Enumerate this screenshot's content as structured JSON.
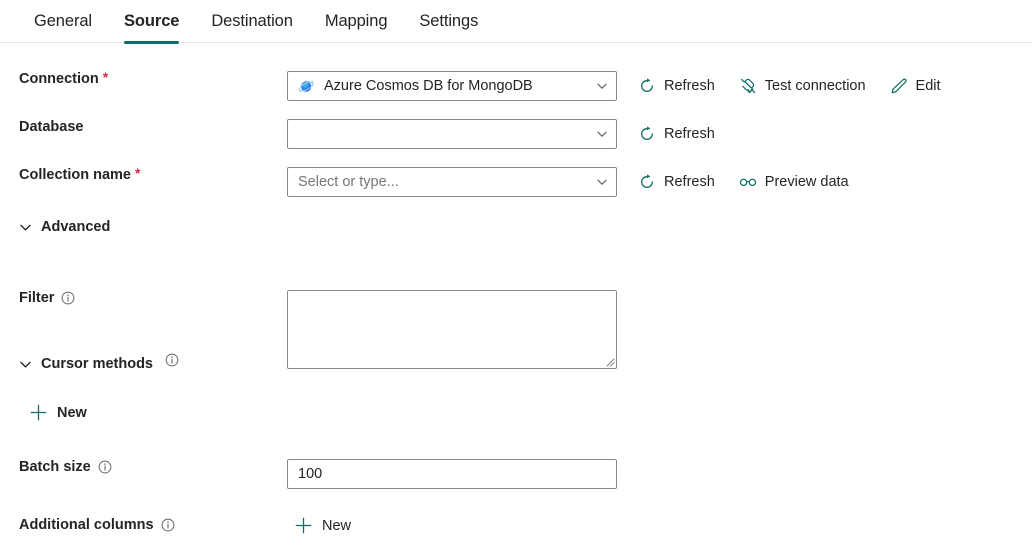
{
  "tabs": [
    {
      "label": "General",
      "active": false
    },
    {
      "label": "Source",
      "active": true
    },
    {
      "label": "Destination",
      "active": false
    },
    {
      "label": "Mapping",
      "active": false
    },
    {
      "label": "Settings",
      "active": false
    }
  ],
  "accent_color": "#0f6e64",
  "required_color": "#c4314b",
  "fields": {
    "connection": {
      "label": "Connection",
      "required": "*",
      "value": "Azure Cosmos DB for MongoDB",
      "icon": "azure-cosmos-db-icon",
      "actions": [
        {
          "label": "Refresh",
          "icon": "refresh-icon"
        },
        {
          "label": "Test connection",
          "icon": "plug-check-icon"
        },
        {
          "label": "Edit",
          "icon": "pencil-icon"
        }
      ]
    },
    "database": {
      "label": "Database",
      "value": "",
      "actions": [
        {
          "label": "Refresh",
          "icon": "refresh-icon"
        }
      ]
    },
    "collection": {
      "label": "Collection name",
      "required": "*",
      "value": "",
      "placeholder": "Select or type...",
      "actions": [
        {
          "label": "Refresh",
          "icon": "refresh-icon"
        },
        {
          "label": "Preview data",
          "icon": "glasses-icon"
        }
      ]
    },
    "filter": {
      "label": "Filter",
      "value": "",
      "info": "info-icon"
    },
    "batch_size": {
      "label": "Batch size",
      "value": "100",
      "info": "info-icon"
    },
    "additional_columns": {
      "label": "Additional columns",
      "info": "info-icon",
      "new_label": "New"
    }
  },
  "sections": {
    "advanced": {
      "label": "Advanced",
      "expanded": true
    },
    "cursor_methods": {
      "label": "Cursor methods",
      "expanded": true,
      "info": "info-icon",
      "new_label": "New"
    }
  }
}
